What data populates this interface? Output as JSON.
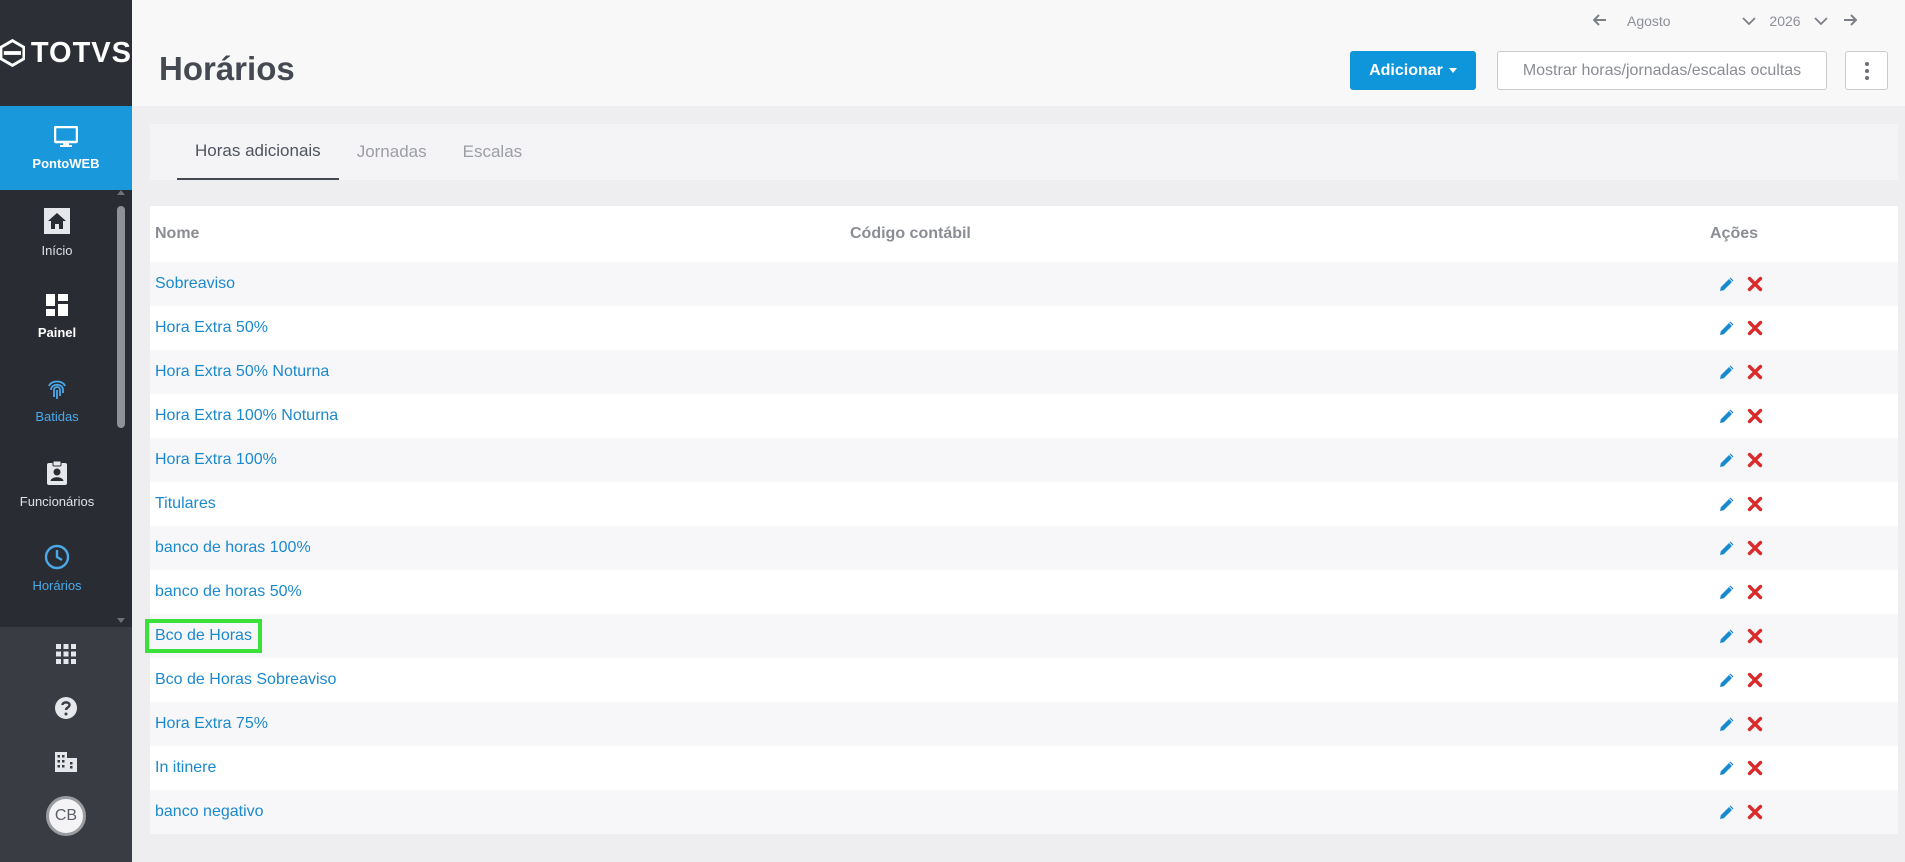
{
  "brand": {
    "name": "TOTVS"
  },
  "sidebar": {
    "module": {
      "label": "PontoWEB",
      "icon": "monitor-icon"
    },
    "items": [
      {
        "label": "Início",
        "icon": "home-icon"
      },
      {
        "label": "Painel",
        "icon": "dashboard-icon"
      },
      {
        "label": "Batidas",
        "icon": "fingerprint-icon"
      },
      {
        "label": "Funcionários",
        "icon": "badge-icon"
      },
      {
        "label": "Horários",
        "icon": "clock-icon"
      }
    ],
    "bottom": [
      {
        "icon": "apps-grid-icon"
      },
      {
        "icon": "help-icon"
      },
      {
        "icon": "building-icon"
      }
    ],
    "avatar": "CB"
  },
  "header": {
    "title": "Horários",
    "date": {
      "month": "Agosto",
      "year": "2026"
    },
    "add_label": "Adicionar",
    "hidden_label": "Mostrar horas/jornadas/escalas ocultas"
  },
  "tabs": [
    {
      "label": "Horas adicionais",
      "active": true
    },
    {
      "label": "Jornadas",
      "active": false
    },
    {
      "label": "Escalas",
      "active": false
    }
  ],
  "table": {
    "headers": {
      "name": "Nome",
      "code": "Código contábil",
      "actions": "Ações"
    },
    "rows": [
      {
        "name": "Sobreaviso",
        "code": ""
      },
      {
        "name": "Hora Extra 50%",
        "code": ""
      },
      {
        "name": "Hora Extra 50% Noturna",
        "code": ""
      },
      {
        "name": "Hora Extra 100% Noturna",
        "code": ""
      },
      {
        "name": "Hora Extra 100%",
        "code": ""
      },
      {
        "name": "Titulares",
        "code": ""
      },
      {
        "name": "banco de horas 100%",
        "code": ""
      },
      {
        "name": "banco de horas 50%",
        "code": ""
      },
      {
        "name": "Bco de Horas",
        "code": ""
      },
      {
        "name": "Bco de Horas Sobreaviso",
        "code": ""
      },
      {
        "name": "Hora Extra 75%",
        "code": ""
      },
      {
        "name": "In itinere",
        "code": ""
      },
      {
        "name": "banco negativo",
        "code": ""
      }
    ]
  },
  "colors": {
    "accent": "#0f95da",
    "link": "#1b89cd",
    "delete": "#d92b2b",
    "highlight": "#3ae13a"
  }
}
